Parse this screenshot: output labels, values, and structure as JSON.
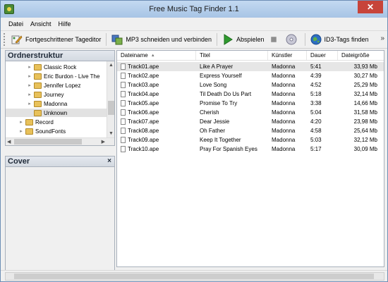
{
  "window": {
    "title": "Free Music Tag Finder 1.1",
    "close_glyph": "✕"
  },
  "menu": [
    {
      "label": "Datei"
    },
    {
      "label": "Ansicht"
    },
    {
      "label": "Hilfe"
    }
  ],
  "toolbar": {
    "tag_editor_label": "Fortgeschrittener Tageditor",
    "mp3_cut_label": "MP3 schneiden und verbinden",
    "play_label": "Abspielen",
    "find_tags_label": "ID3-Tags finden",
    "overflow_glyph": "»"
  },
  "folder_panel": {
    "title": "Ordnerstruktur",
    "items": [
      {
        "label": "Classic Rock",
        "expander": "▸"
      },
      {
        "label": "Eric Burdon - Live The",
        "expander": "▸"
      },
      {
        "label": "Jennifer Lopez",
        "expander": "▸"
      },
      {
        "label": "Journey",
        "expander": "▸"
      },
      {
        "label": "Madonna",
        "expander": "▸"
      },
      {
        "label": "Unknown",
        "expander": "",
        "selected": true
      },
      {
        "label": "Record",
        "expander": "▸"
      },
      {
        "label": "SoundFonts",
        "expander": "▸"
      }
    ]
  },
  "cover_panel": {
    "title": "Cover",
    "close_glyph": "×"
  },
  "file_list": {
    "columns": [
      "Dateiname",
      "Titel",
      "Künstler",
      "Dauer",
      "Dateigröße"
    ],
    "sort_arrow": "▲",
    "rows": [
      {
        "file": "Track01.ape",
        "title": "Like A Prayer",
        "artist": "Madonna",
        "duration": "5:41",
        "size": "33,93 Mb",
        "selected": true
      },
      {
        "file": "Track02.ape",
        "title": "Express Yourself",
        "artist": "Madonna",
        "duration": "4:39",
        "size": "30,27 Mb"
      },
      {
        "file": "Track03.ape",
        "title": "Love Song",
        "artist": "Madonna",
        "duration": "4:52",
        "size": "25,29 Mb"
      },
      {
        "file": "Track04.ape",
        "title": "Til Death Do Us Part",
        "artist": "Madonna",
        "duration": "5:18",
        "size": "32,14 Mb"
      },
      {
        "file": "Track05.ape",
        "title": "Promise To Try",
        "artist": "Madonna",
        "duration": "3:38",
        "size": "14,66 Mb"
      },
      {
        "file": "Track06.ape",
        "title": "Cherish",
        "artist": "Madonna",
        "duration": "5:04",
        "size": "31,58 Mb"
      },
      {
        "file": "Track07.ape",
        "title": "Dear Jessie",
        "artist": "Madonna",
        "duration": "4:20",
        "size": "23,98 Mb"
      },
      {
        "file": "Track08.ape",
        "title": "Oh Father",
        "artist": "Madonna",
        "duration": "4:58",
        "size": "25,64 Mb"
      },
      {
        "file": "Track09.ape",
        "title": "Keep It Together",
        "artist": "Madonna",
        "duration": "5:03",
        "size": "32,12 Mb"
      },
      {
        "file": "Track10.ape",
        "title": "Pray For Spanish Eyes",
        "artist": "Madonna",
        "duration": "5:17",
        "size": "30,09 Mb"
      }
    ]
  }
}
